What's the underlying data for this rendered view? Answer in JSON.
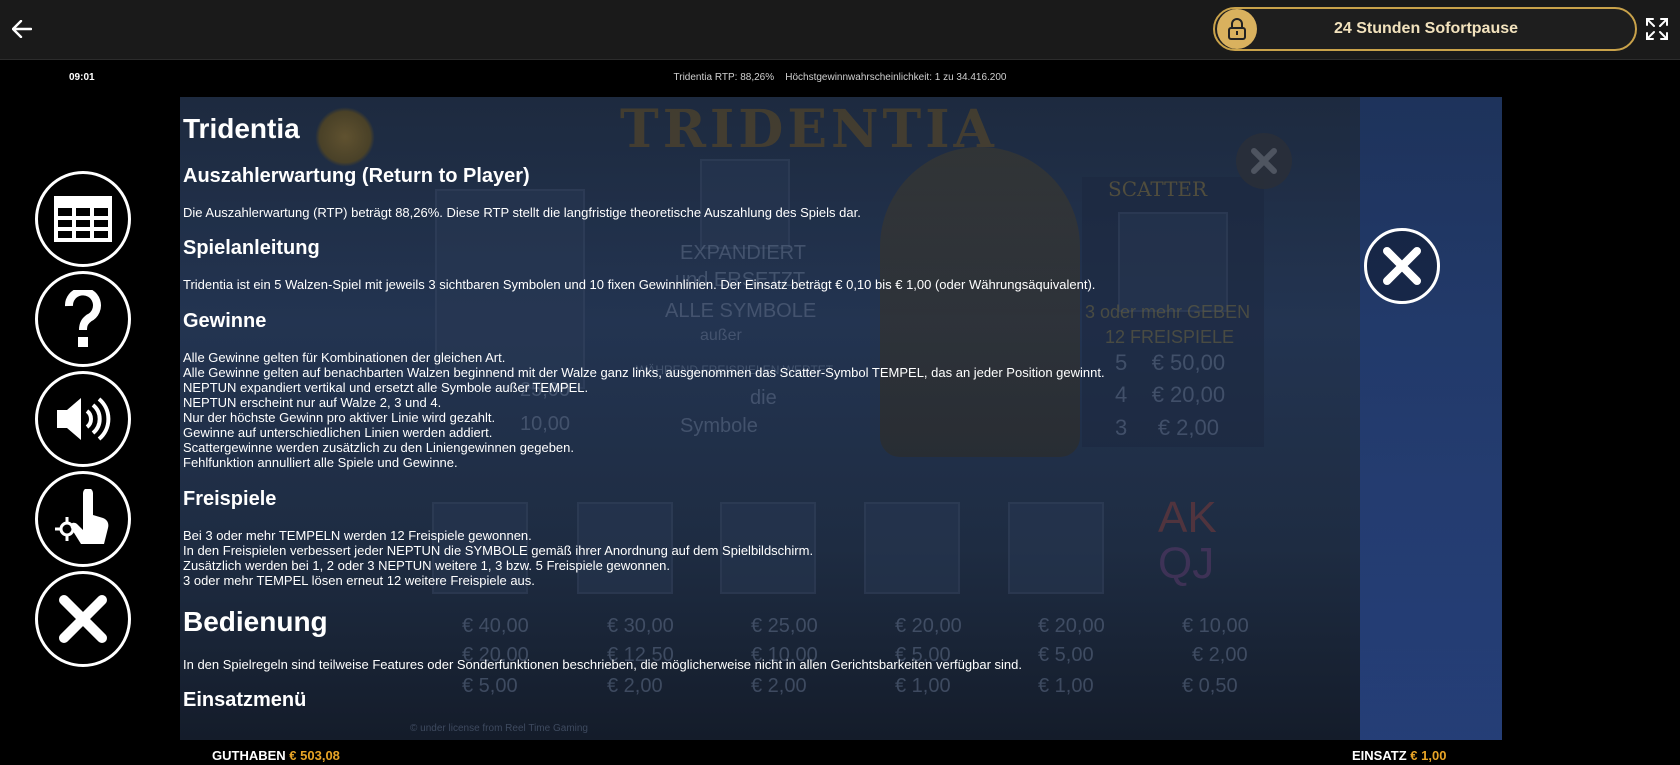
{
  "topbar": {
    "pause_label": "24 Stunden Sofortpause",
    "icons": {
      "back": "arrow-left-icon",
      "lock": "lock-icon",
      "expand": "expand-icon"
    },
    "accent_color": "#c9a24a"
  },
  "infobar": {
    "clock": "09:01",
    "rtp_info": "Tridentia RTP: 88,26%    Höchstgewinnwahrscheinlichkeit: 1 zu 34.416.200"
  },
  "rules": {
    "title": "Tridentia",
    "rtp_heading": "Auszahlerwartung (Return to Player)",
    "rtp_text": "Die Auszahlerwartung (RTP) beträgt 88,26%. Diese RTP stellt die langfristige theoretische Auszahlung des Spiels dar.",
    "guide_heading": "Spielanleitung",
    "guide_text": "Tridentia ist ein 5 Walzen-Spiel mit jeweils 3 sichtbaren Symbolen und 10 fixen Gewinnlinien. Der Einsatz beträgt € 0,10 bis € 1,00 (oder Währungsäquivalent).",
    "wins_heading": "Gewinne",
    "wins_lines": [
      "Alle Gewinne gelten für Kombinationen der gleichen Art.",
      "Alle Gewinne gelten auf benachbarten Walzen beginnend mit der Walze ganz links, ausgenommen das Scatter-Symbol TEMPEL, das an jeder Position gewinnt.",
      "NEPTUN expandiert vertikal und ersetzt alle Symbole außer TEMPEL.",
      "NEPTUN erscheint nur auf Walze 2, 3 und 4.",
      "Nur der höchste Gewinn pro aktiver Linie wird gezahlt.",
      "Gewinne auf unterschiedlichen Linien werden addiert.",
      "Scattergewinne werden zusätzlich zu den Liniengewinnen gegeben.",
      "Fehlfunktion annulliert alle Spiele und Gewinne."
    ],
    "freespins_heading": "Freispiele",
    "freespins_lines": [
      "Bei 3 oder mehr TEMPELN werden 12 Freispiele gewonnen.",
      "In den Freispielen verbessert jeder NEPTUN die SYMBOLE gemäß ihrer Anordnung auf dem Spielbildschirm.",
      "Zusätzlich werden bei 1, 2 oder 3 NEPTUN weitere 1, 3 bzw. 5 Freispiele gewonnen.",
      "3 oder mehr TEMPEL lösen erneut 12 weitere Freispiele aus."
    ],
    "controls_heading": "Bedienung",
    "controls_text": "In den Spielregeln sind teilweise Features oder Sonderfunktionen beschrieben, die möglicherweise nicht in allen Gerichtsbarkeiten verfügbar sind.",
    "stake_menu_heading": "Einsatzmenü"
  },
  "background": {
    "logo": "TRIDENTIA",
    "expand_text": "EXPANDIERT",
    "replace_text": "und ERSETZT",
    "all_symbols": "ALLE SYMBOLE",
    "except": "außer",
    "during_freespins": "WÄHREND FREISPIELEN WERTET",
    "the": "die",
    "symbols": "Symbole",
    "scatter": "SCATTER",
    "scatter_award_1": "3 oder mehr GEBEN",
    "scatter_award_2": "12 FREISPIELE",
    "scatter_pays": [
      {
        "count": "5",
        "value": "€ 50,00"
      },
      {
        "count": "4",
        "value": "€ 20,00"
      },
      {
        "count": "3",
        "value": "€ 2,00"
      }
    ],
    "left_pay_1": "25,00",
    "left_pay_2": "10,00",
    "card_letters": "AK",
    "card_letters_2": "QJ",
    "paytable": [
      {
        "five": "€ 40,00",
        "four": "€ 20,00",
        "three": "€ 5,00"
      },
      {
        "five": "€ 30,00",
        "four": "€ 12,50",
        "three": "€ 2,00"
      },
      {
        "five": "€ 25,00",
        "four": "€ 10,00",
        "three": "€ 2,00"
      },
      {
        "five": "€ 20,00",
        "four": "€ 5,00",
        "three": "€ 1,00"
      },
      {
        "five": "€ 20,00",
        "four": "€ 5,00",
        "three": "€ 1,00"
      },
      {
        "five": "€ 10,00",
        "four": "€ 2,00",
        "three": "€ 0,50"
      }
    ],
    "license": "© under license from Reel Time Gaming"
  },
  "menu": {
    "icons": [
      "paytable-icon",
      "help-icon",
      "sound-icon",
      "touch-settings-icon",
      "close-icon"
    ]
  },
  "bottombar": {
    "balance_label": "GUTHABEN",
    "balance_value": "€ 503,08",
    "stake_label": "EINSATZ",
    "stake_value": "€ 1,00",
    "accent_color": "#e8a426"
  }
}
